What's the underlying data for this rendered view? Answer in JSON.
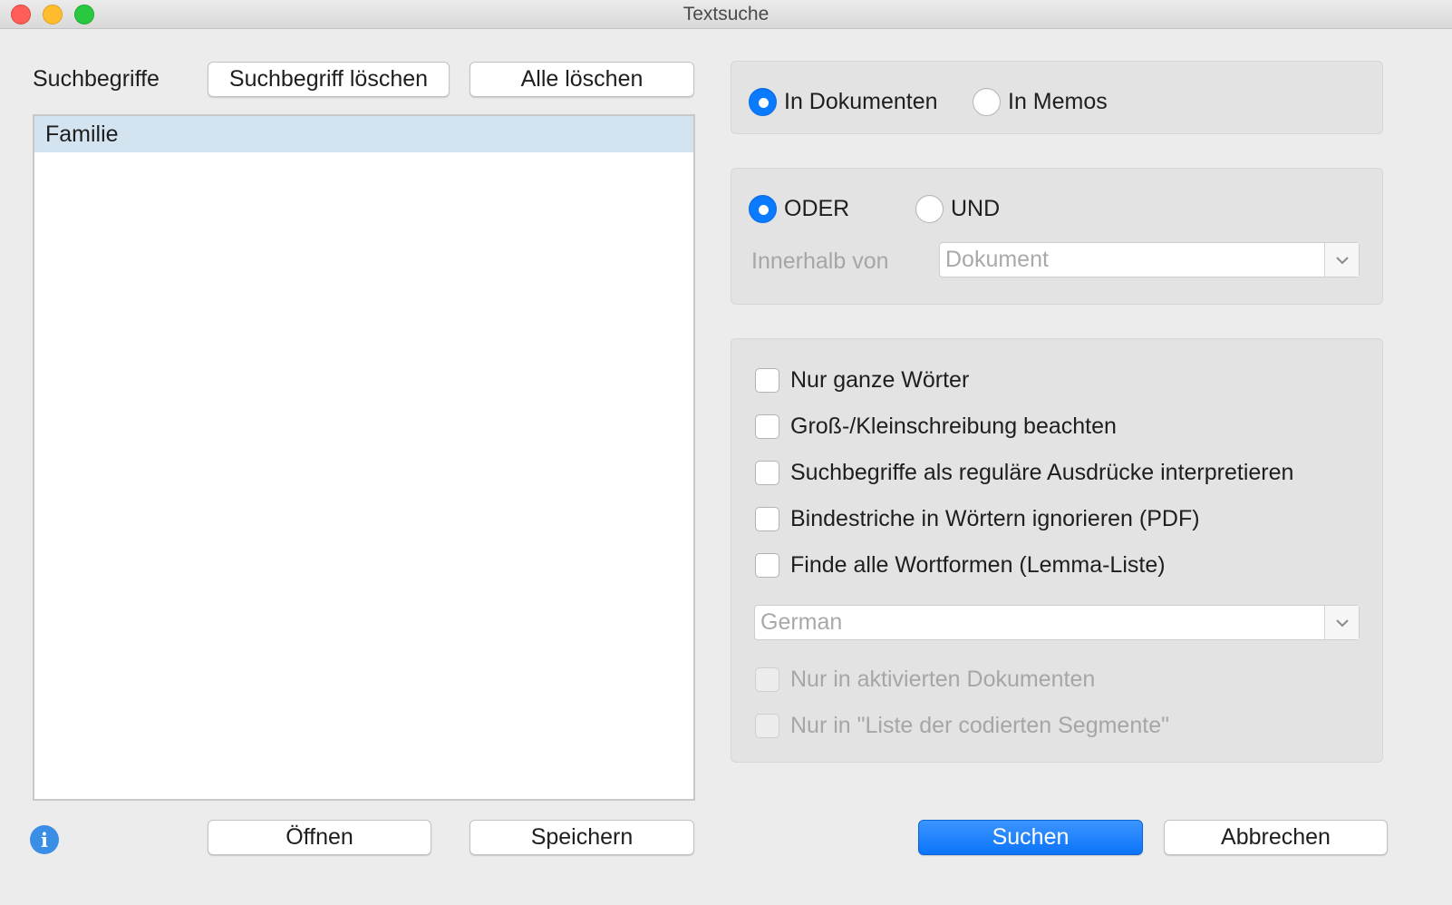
{
  "window": {
    "title": "Textsuche"
  },
  "left": {
    "heading": "Suchbegriffe",
    "delete_term_label": "Suchbegriff löschen",
    "delete_all_label": "Alle löschen",
    "terms": [
      "Familie"
    ],
    "open_label": "Öffnen",
    "save_label": "Speichern"
  },
  "scope": {
    "options": [
      {
        "label": "In Dokumenten",
        "selected": true
      },
      {
        "label": "In Memos",
        "selected": false
      }
    ]
  },
  "logic": {
    "options": [
      {
        "label": "ODER",
        "selected": true
      },
      {
        "label": "UND",
        "selected": false
      }
    ],
    "within_label": "Innerhalb von",
    "within_value": "Dokument"
  },
  "options": {
    "checkboxes": [
      {
        "label": "Nur ganze Wörter",
        "checked": false,
        "enabled": true
      },
      {
        "label": "Groß-/Kleinschreibung beachten",
        "checked": false,
        "enabled": true
      },
      {
        "label": "Suchbegriffe als reguläre Ausdrücke interpretieren",
        "checked": false,
        "enabled": true
      },
      {
        "label": "Bindestriche in Wörtern ignorieren (PDF)",
        "checked": false,
        "enabled": true
      },
      {
        "label": "Finde alle Wortformen (Lemma-Liste)",
        "checked": false,
        "enabled": true
      }
    ],
    "language_value": "German",
    "disabled_checkboxes": [
      {
        "label": "Nur in aktivierten Dokumenten",
        "checked": false,
        "enabled": false
      },
      {
        "label": "Nur in \"Liste der codierten Segmente\"",
        "checked": false,
        "enabled": false
      }
    ]
  },
  "footer": {
    "search_label": "Suchen",
    "cancel_label": "Abbrechen"
  },
  "icons": {
    "info": "info-icon",
    "dropdown": "chevron-down-icon"
  },
  "colors": {
    "accent": "#0a7aff",
    "selection": "#d4e3f0"
  }
}
